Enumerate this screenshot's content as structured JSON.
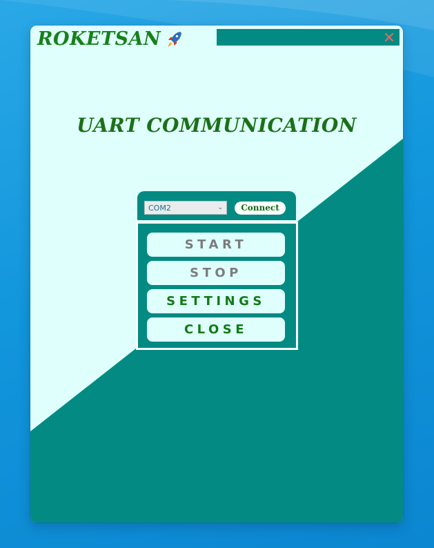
{
  "app": {
    "brand": "ROKETSAN",
    "brand_icon": "rocket-icon",
    "close_icon": "close-icon",
    "heading": "UART COMMUNICATION"
  },
  "connection": {
    "port_value": "COM2",
    "connect_label": "Connect"
  },
  "actions": {
    "start_label": "START",
    "stop_label": "STOP",
    "settings_label": "SETTINGS",
    "close_label": "CLOSE"
  },
  "colors": {
    "teal": "#038b83",
    "light_cyan": "#dffffd",
    "green": "#17801a",
    "gray": "#7a7d7d"
  }
}
